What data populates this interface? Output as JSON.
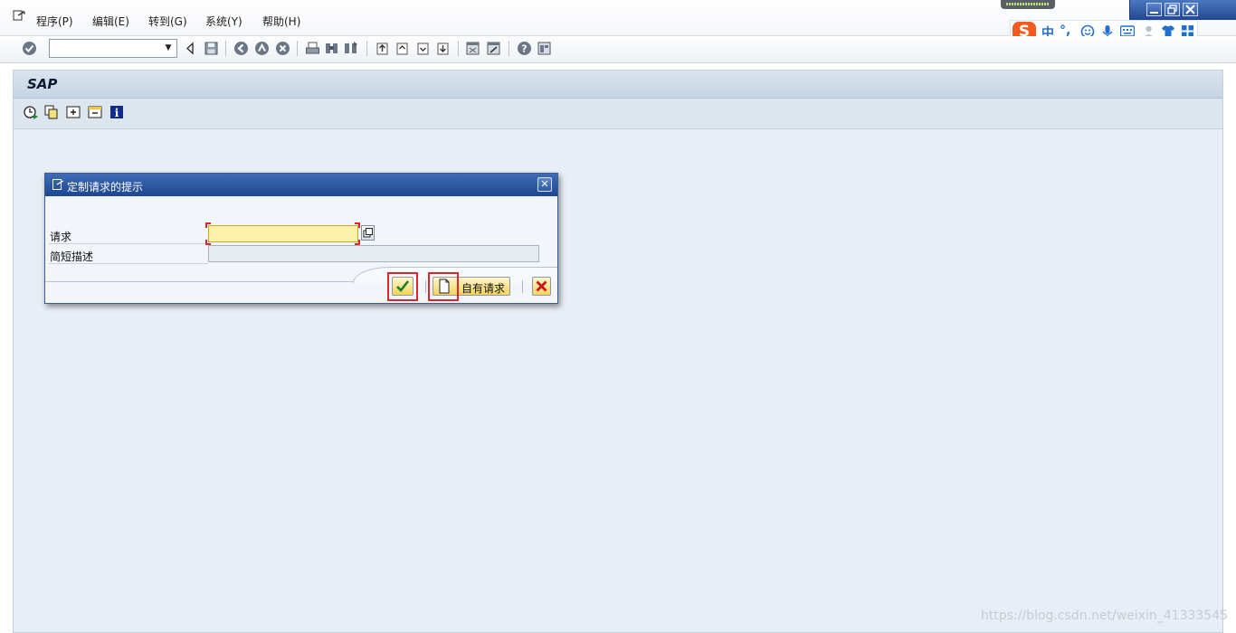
{
  "menu": {
    "items": [
      "程序(P)",
      "编辑(E)",
      "转到(G)",
      "系统(Y)",
      "帮助(H)"
    ]
  },
  "ime": {
    "logo": "S",
    "lang": "中",
    "punct": "°,"
  },
  "header": {
    "title": "SAP"
  },
  "dialog": {
    "title": "定制请求的提示",
    "close": "✕",
    "fields": [
      {
        "label": "请求",
        "value": ""
      },
      {
        "label": "简短描述",
        "value": ""
      }
    ],
    "buttons": {
      "own_requests": "自有请求"
    }
  },
  "watermark": "https://blog.csdn.net/weixin_41333545",
  "colors": {
    "title_blue": "#1f4690",
    "field_yellow": "#fdf0a8",
    "highlight_red": "#d9272d"
  }
}
